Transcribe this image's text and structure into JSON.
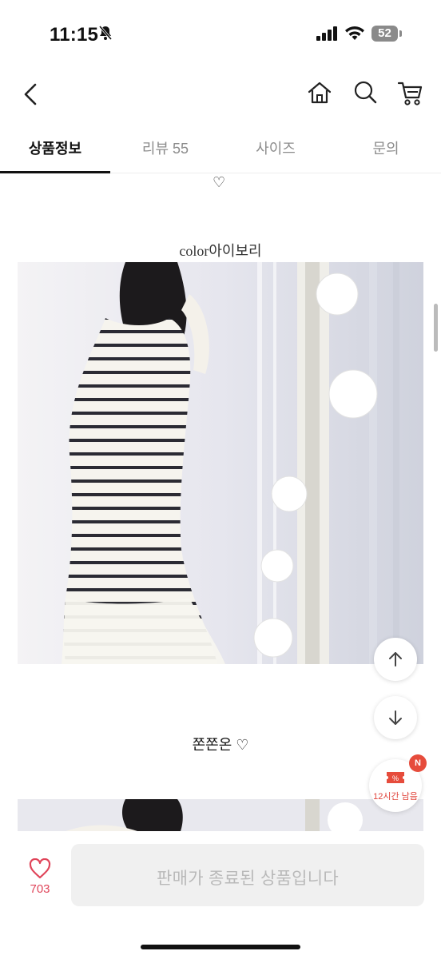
{
  "status": {
    "time": "11:15",
    "battery": "52"
  },
  "nav": {
    "back_icon": "chevron-left-icon",
    "home_icon": "home-icon",
    "search_icon": "search-icon",
    "cart_icon": "cart-icon"
  },
  "tabs": [
    {
      "label": "상품정보",
      "active": true
    },
    {
      "label": "리뷰 55",
      "active": false
    },
    {
      "label": "사이즈",
      "active": false
    },
    {
      "label": "문의",
      "active": false
    }
  ],
  "content": {
    "heart_line": "♡",
    "color_caption": "color아이보리",
    "caption2": "쫀쫀온 ♡"
  },
  "floating": {
    "coupon_badge": "N",
    "coupon_text": "12시간 남음"
  },
  "bottom": {
    "like_count": "703",
    "sold_out_label": "판매가 종료된 상품입니다"
  },
  "colors": {
    "accent": "#e64c3c",
    "like": "#e0455a",
    "disabled_bg": "#f0f0f0",
    "disabled_text": "#b9b9b9"
  }
}
